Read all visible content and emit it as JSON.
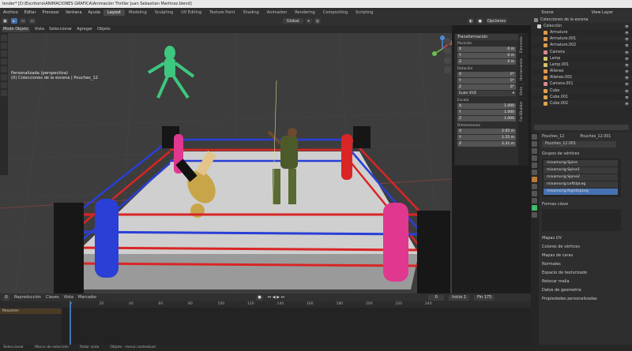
{
  "window": {
    "title": "lender* [D:\\Escritorio\\ANIMACIONES GRAFICA\\Animación Thriller Juan Sebastian Martinez.blend]"
  },
  "menu": [
    "Archivo",
    "Editar",
    "Procesar",
    "Ventana",
    "Ayuda"
  ],
  "workspaces": [
    "Layout",
    "Modeling",
    "Sculpting",
    "UV Editing",
    "Texture Paint",
    "Shading",
    "Animation",
    "Rendering",
    "Compositing",
    "Scripting"
  ],
  "active_workspace": "Layout",
  "scene": {
    "scene_label": "Scene",
    "view_layer": "View Layer"
  },
  "viewport_header": {
    "mode": "Modo Objeto",
    "items": [
      "Vista",
      "Seleccionar",
      "Agregar",
      "Objeto"
    ],
    "transform": "Global",
    "options": "Opciones"
  },
  "viewport_info": {
    "line1": "Personalizada (perspectiva)",
    "line2": "(0) Colecciones de la escena | Pouches_12"
  },
  "npanel": {
    "header": "Transformación",
    "posicion": "Posición",
    "pos": [
      {
        "axis": "X",
        "val": "0 m"
      },
      {
        "axis": "Y",
        "val": "0 m"
      },
      {
        "axis": "Z",
        "val": "0 m"
      }
    ],
    "rotacion": "Rotación",
    "rot": [
      {
        "axis": "X",
        "val": "0°"
      },
      {
        "axis": "Y",
        "val": "0°"
      },
      {
        "axis": "Z",
        "val": "0°"
      }
    ],
    "euler": "Euler XYZ",
    "escala": "Escala",
    "scale": [
      {
        "axis": "X",
        "val": "1.000"
      },
      {
        "axis": "Y",
        "val": "1.000"
      },
      {
        "axis": "Z",
        "val": "1.000"
      }
    ],
    "dimensiones": "Dimensiones",
    "dims": [
      {
        "axis": "X",
        "val": "2.05 m"
      },
      {
        "axis": "Y",
        "val": "1.55 m"
      },
      {
        "axis": "Z",
        "val": "2.21 m"
      }
    ],
    "tabs": [
      "Elemento",
      "Herramienta",
      "Vista",
      "FacilBuilder"
    ]
  },
  "outliner": {
    "header": "Colecciones de la escena",
    "rows": [
      {
        "name": "Colección",
        "color": "#d0d0d0"
      },
      {
        "name": "Armature",
        "color": "#e09a4a"
      },
      {
        "name": "Armature.001",
        "color": "#e09a4a"
      },
      {
        "name": "Armature.002",
        "color": "#e09a4a"
      },
      {
        "name": "Camera",
        "color": "#d88a8a"
      },
      {
        "name": "Lamp",
        "color": "#d6c36a"
      },
      {
        "name": "Lamp.001",
        "color": "#d6c36a"
      },
      {
        "name": "Alienex",
        "color": "#e09a4a"
      },
      {
        "name": "Alienex.001",
        "color": "#e09a4a"
      },
      {
        "name": "Camera.001",
        "color": "#d88a8a"
      },
      {
        "name": "Cube",
        "color": "#e0a050"
      },
      {
        "name": "Cube.001",
        "color": "#e0a050"
      },
      {
        "name": "Cube.002",
        "color": "#e0a050"
      }
    ]
  },
  "properties": {
    "object": "Pouches_12",
    "mesh": "Pouches_12.001",
    "mesh_data": "Pouches_12.001",
    "vertex_groups_title": "Grupos de vértices",
    "vertex_groups": [
      "mixamorig:Spine",
      "mixamorig:Spine1",
      "mixamorig:Spine2",
      "mixamorig:LeftUpLeg",
      "mixamorig:RightUpLeg"
    ],
    "selected_group": "mixamorig:RightUpLeg",
    "shape_keys": "Formas clave",
    "sections": [
      "Mapas UV",
      "Colores de vértices",
      "Mapas de caras",
      "Normales",
      "Espacio de texturizado",
      "Retocar malla",
      "Datos de geometría",
      "Propiedades personalizadas"
    ]
  },
  "timeline": {
    "menu": [
      "Reproducción",
      "Claves",
      "Vista",
      "Marcador"
    ],
    "current_frame": "0",
    "inicio_label": "Inicio",
    "inicio": "1",
    "fin_label": "Fin",
    "fin": "175",
    "ticks": [
      "0",
      "20",
      "40",
      "60",
      "80",
      "100",
      "120",
      "140",
      "160",
      "180",
      "200",
      "220",
      "240"
    ],
    "summary": "Resumen"
  },
  "status": [
    "Seleccionar",
    "Marco de selección",
    "Rotar vista",
    "Objeto - menú contextual"
  ],
  "colors": {
    "accent": "#4772b3",
    "ring_red": "#d92525",
    "ring_blue": "#2a3fd6",
    "post_pink": "#e0378f",
    "alien": "#3fe08a"
  }
}
